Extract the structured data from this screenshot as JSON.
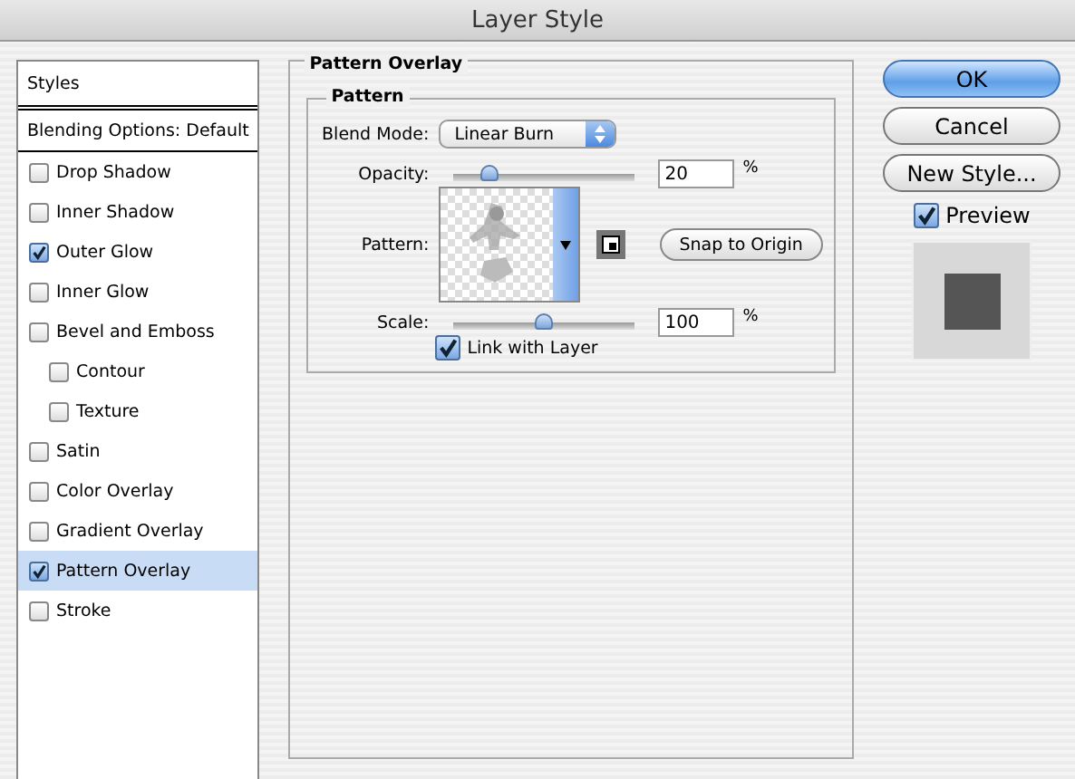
{
  "window": {
    "title": "Layer Style"
  },
  "styles_list": {
    "header": "Styles",
    "blending_options": "Blending Options: Default",
    "items": [
      {
        "label": "Drop Shadow",
        "checked": false,
        "selected": false
      },
      {
        "label": "Inner Shadow",
        "checked": false,
        "selected": false
      },
      {
        "label": "Outer Glow",
        "checked": true,
        "selected": false
      },
      {
        "label": "Inner Glow",
        "checked": false,
        "selected": false
      },
      {
        "label": "Bevel and Emboss",
        "checked": false,
        "selected": false,
        "children": [
          {
            "label": "Contour",
            "checked": false,
            "selected": false
          },
          {
            "label": "Texture",
            "checked": false,
            "selected": false
          }
        ]
      },
      {
        "label": "Satin",
        "checked": false,
        "selected": false
      },
      {
        "label": "Color Overlay",
        "checked": false,
        "selected": false
      },
      {
        "label": "Gradient Overlay",
        "checked": false,
        "selected": false
      },
      {
        "label": "Pattern Overlay",
        "checked": true,
        "selected": true
      },
      {
        "label": "Stroke",
        "checked": false,
        "selected": false
      }
    ]
  },
  "panel": {
    "title": "Pattern Overlay",
    "group_title": "Pattern",
    "blend_mode": {
      "label": "Blend Mode:",
      "value": "Linear Burn"
    },
    "opacity": {
      "label": "Opacity:",
      "level": 0.2,
      "value": "20",
      "unit": "%"
    },
    "pattern": {
      "label": "Pattern:",
      "snap_button": "Snap to Origin"
    },
    "scale": {
      "label": "Scale:",
      "level": 0.5,
      "value": "100",
      "unit": "%"
    },
    "link_with_layer": {
      "label": "Link with Layer",
      "checked": true
    }
  },
  "buttons": {
    "ok": "OK",
    "cancel": "Cancel",
    "new_style": "New Style..."
  },
  "preview": {
    "label": "Preview",
    "checked": true
  }
}
